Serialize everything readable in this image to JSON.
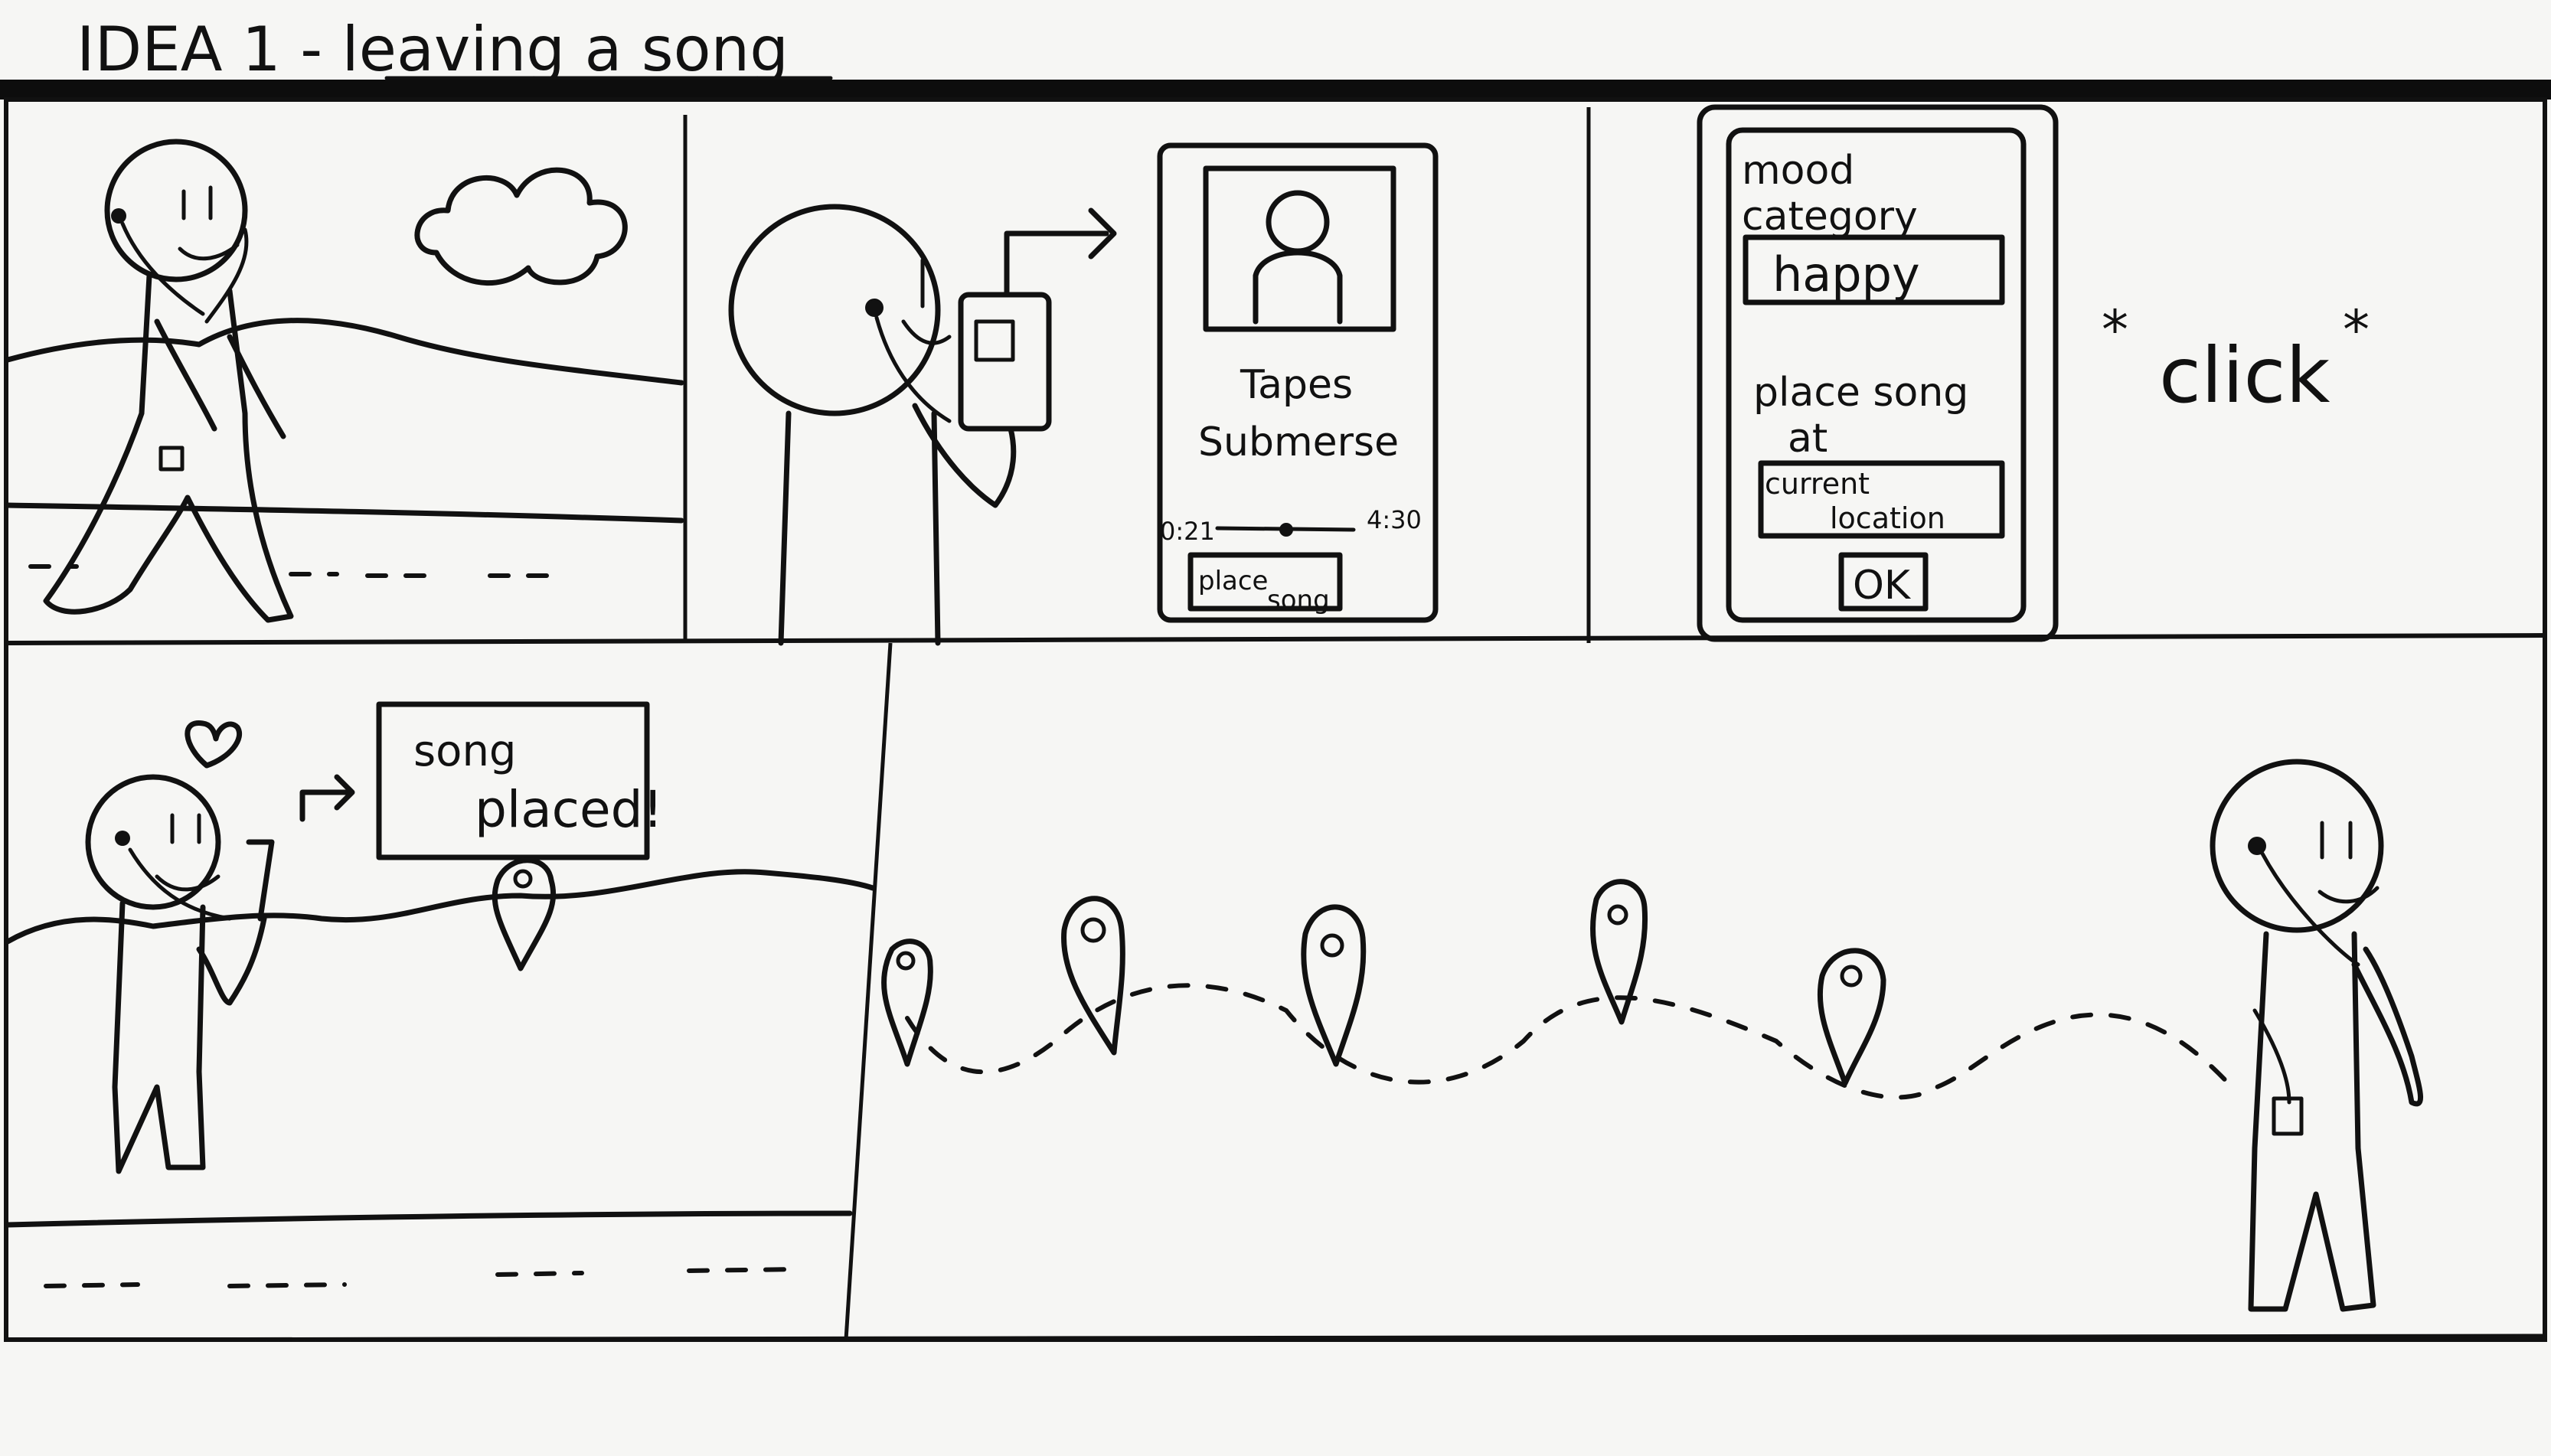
{
  "title": "IDEA 1 - leaving a song",
  "panel2": {
    "song_title": "Tapes",
    "artist": "Submerse",
    "time_start": "0:21",
    "time_end": "4:30",
    "button_label_1": "place",
    "button_label_2": "song"
  },
  "panel3": {
    "mood_label_1": "mood",
    "mood_label_2": "category",
    "mood_value": "happy",
    "place_label_1": "place song",
    "place_label_2": "at",
    "location_value_1": "current",
    "location_value_2": "location",
    "ok_label": "OK",
    "click_text": "click"
  },
  "panel4": {
    "confirm_1": "song",
    "confirm_2": "placed!"
  },
  "icons": [
    "stick-figure",
    "cloud",
    "heart",
    "arrow",
    "map-pin"
  ]
}
